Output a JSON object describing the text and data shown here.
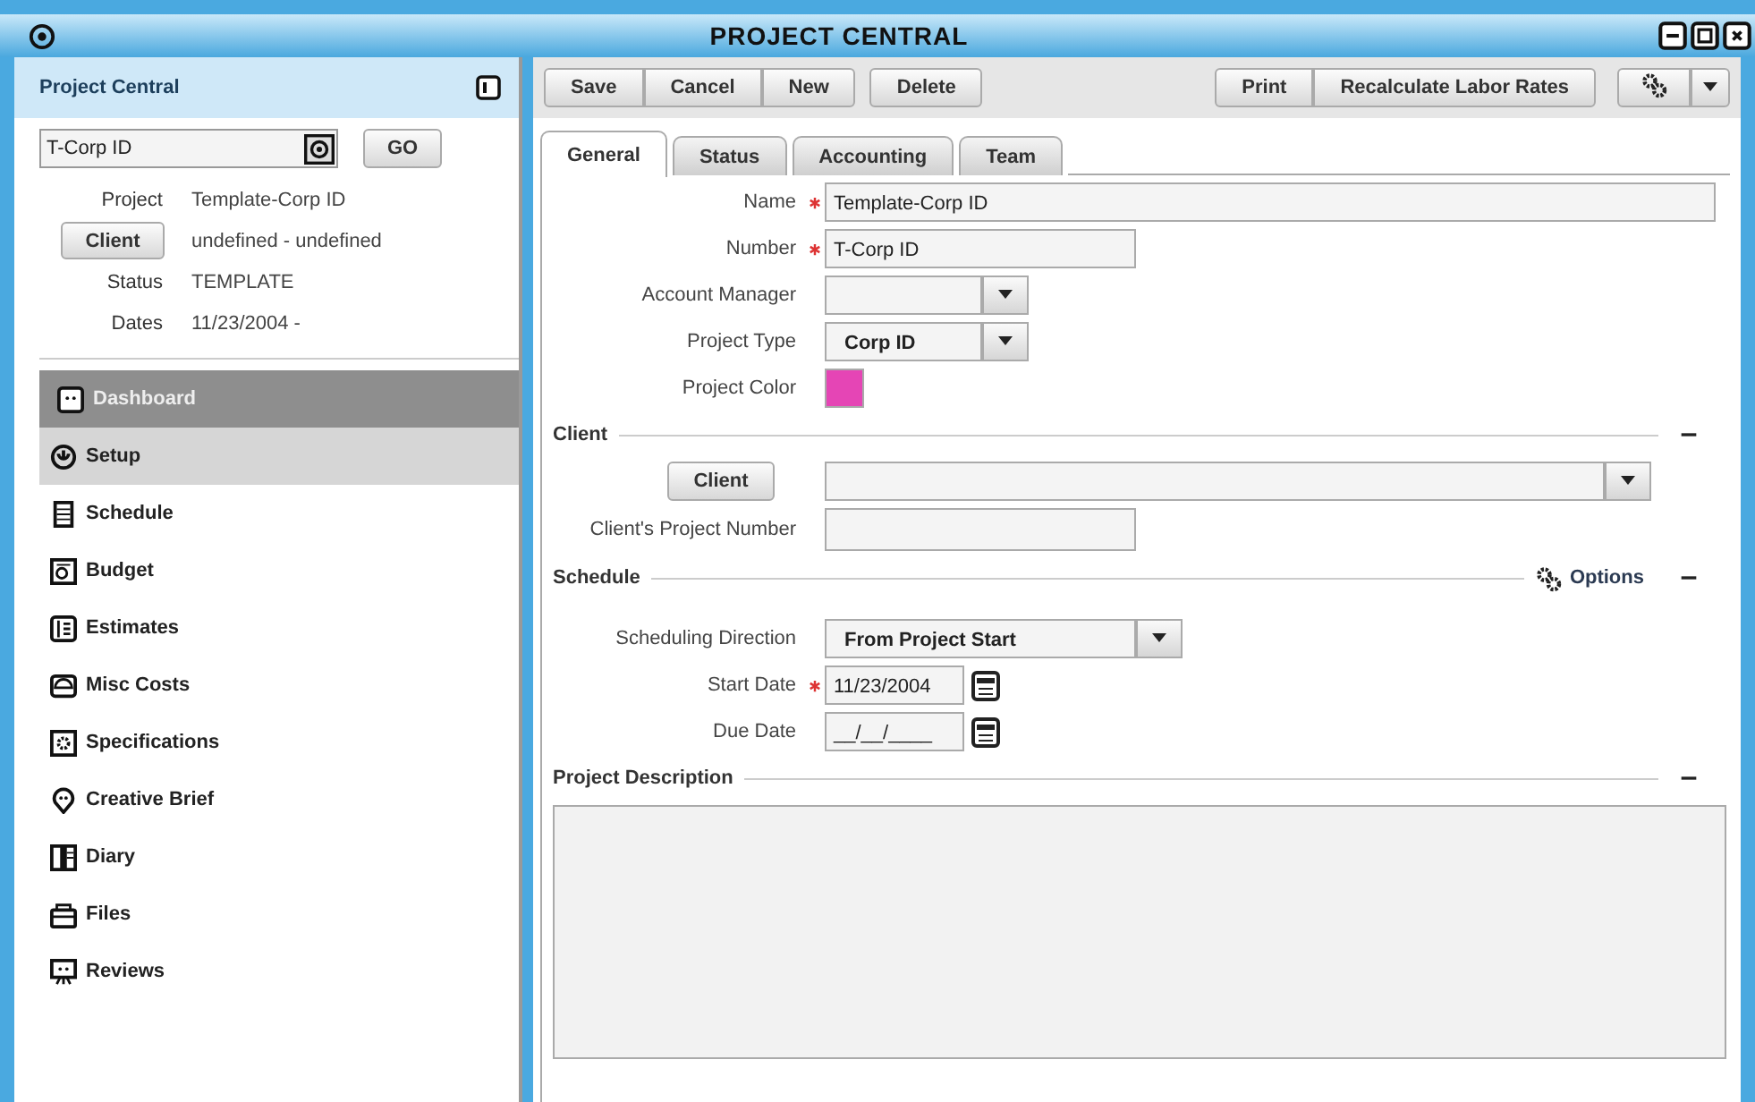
{
  "window": {
    "title": "PROJECT CENTRAL"
  },
  "sidebar": {
    "title": "Project Central",
    "search": {
      "value": "T-Corp ID"
    },
    "go_button": "GO",
    "info": [
      {
        "kind": "text",
        "label": "Project",
        "value": "Template-Corp ID"
      },
      {
        "kind": "button",
        "label": "Client",
        "value": "undefined - undefined"
      },
      {
        "kind": "text",
        "label": "Status",
        "value": "TEMPLATE"
      },
      {
        "kind": "text",
        "label": "Dates",
        "value": "11/23/2004 -"
      }
    ],
    "items": [
      {
        "label": "Dashboard",
        "selected": true,
        "highlighted": false
      },
      {
        "label": "Setup",
        "selected": false,
        "highlighted": true
      },
      {
        "label": "Schedule",
        "selected": false,
        "highlighted": false
      },
      {
        "label": "Budget",
        "selected": false,
        "highlighted": false
      },
      {
        "label": "Estimates",
        "selected": false,
        "highlighted": false
      },
      {
        "label": "Misc Costs",
        "selected": false,
        "highlighted": false
      },
      {
        "label": "Specifications",
        "selected": false,
        "highlighted": false
      },
      {
        "label": "Creative Brief",
        "selected": false,
        "highlighted": false
      },
      {
        "label": "Diary",
        "selected": false,
        "highlighted": false
      },
      {
        "label": "Files",
        "selected": false,
        "highlighted": false
      },
      {
        "label": "Reviews",
        "selected": false,
        "highlighted": false
      }
    ]
  },
  "toolbar": {
    "left_buttons": [
      "Save",
      "Cancel",
      "New",
      "Delete"
    ],
    "right_buttons": [
      "Print",
      "Recalculate Labor Rates"
    ]
  },
  "tabs": [
    {
      "label": "General",
      "selected": true
    },
    {
      "label": "Status",
      "selected": false
    },
    {
      "label": "Accounting",
      "selected": false
    },
    {
      "label": "Team",
      "selected": false
    }
  ],
  "general": [
    {
      "kind": "text",
      "label": "Name",
      "required": true,
      "value": "Template-Corp ID"
    },
    {
      "kind": "text",
      "label": "Number",
      "required": true,
      "value": "T-Corp ID"
    },
    {
      "kind": "select",
      "label": "Account Manager",
      "required": false
    },
    {
      "kind": "select",
      "label": "Project Type",
      "required": false,
      "value": "Corp ID"
    },
    {
      "kind": "color",
      "label": "Project Color",
      "required": false,
      "color": "#e545b5"
    }
  ],
  "client_section": {
    "title": "Client",
    "expanded": true,
    "button": "Client",
    "project_number_label": "Client's Project Number"
  },
  "schedule_section": {
    "title": "Schedule",
    "expanded": true,
    "options": "Options",
    "fields": [
      {
        "kind": "select",
        "label": "Scheduling Direction",
        "required": false,
        "value": "From Project Start"
      },
      {
        "kind": "date",
        "label": "Start Date",
        "required": true,
        "value": "11/23/2004"
      },
      {
        "kind": "date",
        "label": "Due Date",
        "required": false,
        "value": "__/__/____"
      }
    ]
  },
  "description_section": {
    "title": "Project Description",
    "expanded": true
  }
}
